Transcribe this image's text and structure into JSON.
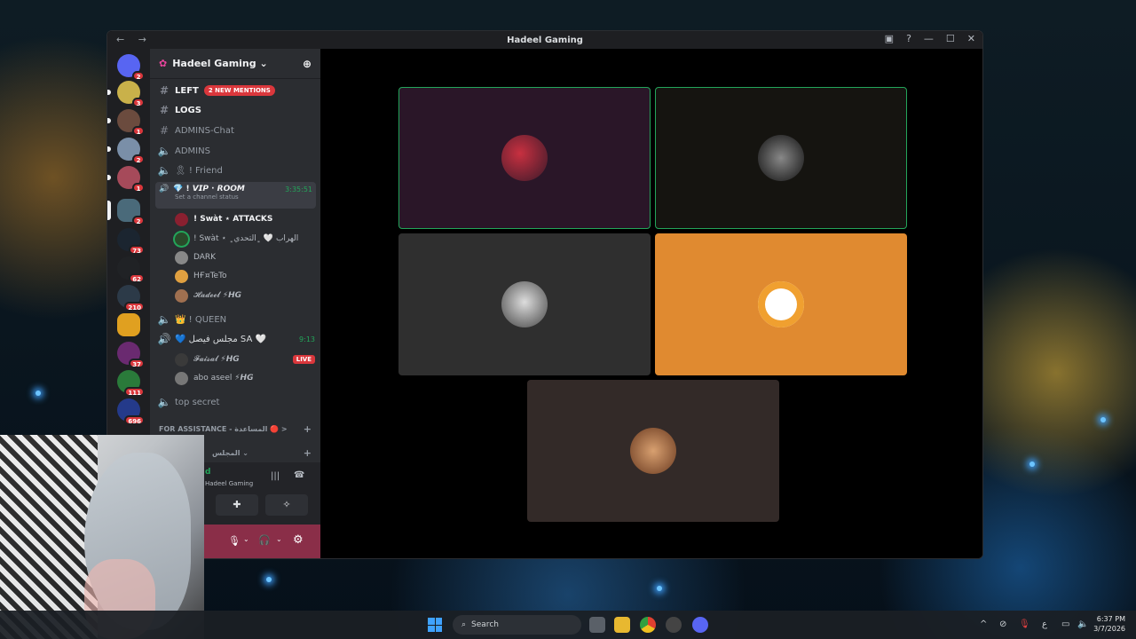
{
  "window": {
    "title": "Hadeel Gaming",
    "nav": "← →"
  },
  "server": {
    "name": "Hadeel Gaming ⌄"
  },
  "channels": [
    {
      "name": "LEFT",
      "type": "text",
      "mention": "2 NEW MENTIONS"
    },
    {
      "name": "LOGS",
      "type": "text"
    },
    {
      "name": "ADMINS-Chat",
      "type": "text"
    },
    {
      "name": "ADMINS",
      "type": "voice"
    },
    {
      "name": "🎗 ! Friend",
      "type": "voice"
    }
  ],
  "vip": {
    "name": "💎 ! 𝙑𝙄𝙋 · 𝙍𝙊𝙊𝙈",
    "timer": "3:35:51",
    "status": "Set a channel status"
  },
  "vip_users": [
    "! Swàt ⋆ ATTACKS",
    "! Swàt ⋆ الهراب 🤍 ﮼اﻟﺘﺤﺪﻱ﮼",
    "DARK",
    "HҒ¤TeTo",
    "𝓗𝓪𝓭𝓮𝓮𝓵 ⚡𝙃𝙂"
  ],
  "queen": {
    "name": "👑 ! QUEEN"
  },
  "sa": {
    "name": "💙 مجلس فيصل SA 🤍",
    "timer": "9:13"
  },
  "sa_users": [
    {
      "name": "𝓕𝓪𝓲𝓼𝓪𝓵 ⚡𝙃𝙂",
      "live": "LIVE"
    },
    {
      "name": "abo aseel ⚡𝙃𝙂"
    }
  ],
  "top_secret": "top secret",
  "categories": {
    "assist": "FOR ASSISTANCE - المساعدة 🔴 >",
    "majlis": "المجلس ⌄"
  },
  "voice_panel": {
    "status": "d",
    "server": "Hadeel Gaming"
  },
  "guild_badges": [
    "2",
    "3",
    "1",
    "2",
    "1",
    "2",
    "73",
    "62",
    "210",
    "37",
    "111",
    "696"
  ],
  "taskbar": {
    "search": "Search",
    "time": "6:37 PM",
    "date": "3/7/2026",
    "lang": "ع"
  },
  "colors": {
    "accent": "#5865f2",
    "red": "#da373c",
    "green": "#23a55a"
  }
}
